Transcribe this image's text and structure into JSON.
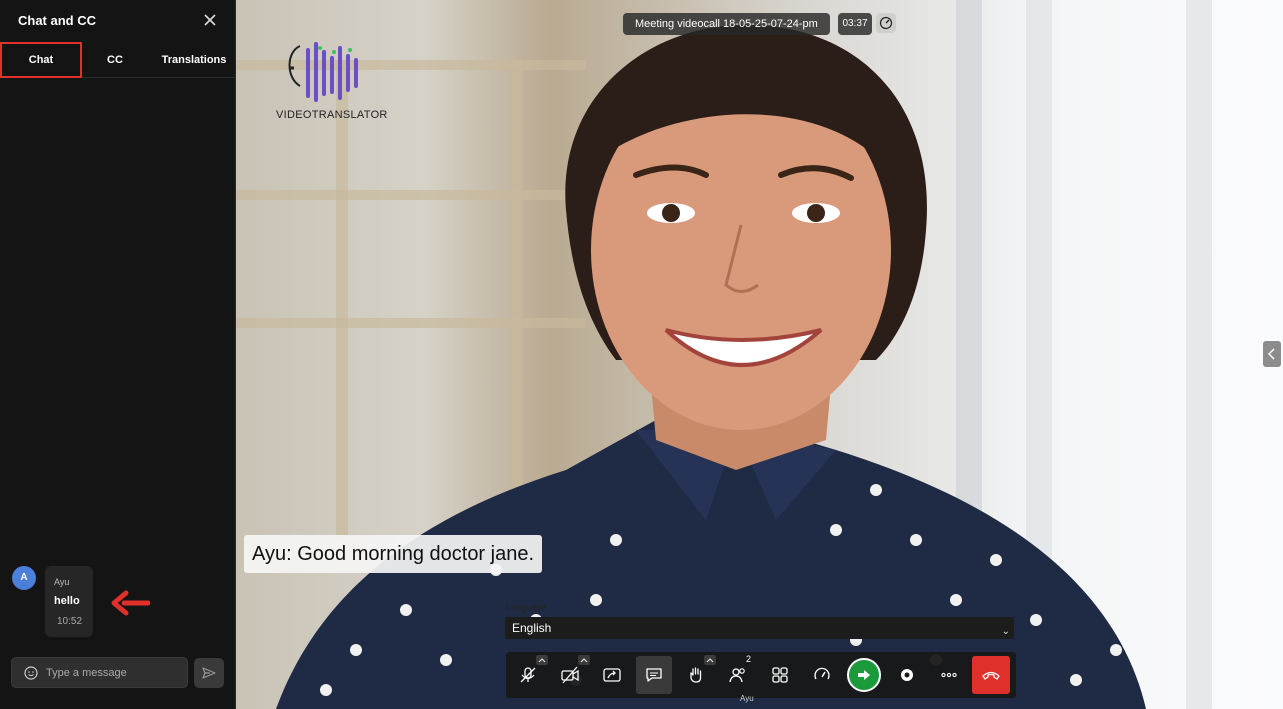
{
  "sidebar": {
    "title": "Chat and CC",
    "tabs": [
      "Chat",
      "CC",
      "Translations"
    ],
    "active_tab": "Chat",
    "messages": [
      {
        "avatar_initial": "A",
        "author": "Ayu",
        "text": "hello",
        "time": "10:52"
      }
    ],
    "input": {
      "placeholder": "Type a message",
      "value": ""
    }
  },
  "video": {
    "logo_text": "VIDEOTRANSLATOR",
    "meeting_title": "Meeting videocall 18-05-25-07-24-pm",
    "timer": "03:37",
    "caption": "Ayu: Good morning doctor jane.",
    "language": {
      "label": "Language",
      "selected": "English"
    },
    "toolbar": {
      "participants_count": "2",
      "user_name": "Ayu",
      "buttons": [
        "mic-off",
        "video-off",
        "share-screen",
        "chat",
        "raise-hand",
        "participants",
        "apps",
        "stats",
        "enter",
        "record",
        "more",
        "leave"
      ]
    }
  },
  "colors": {
    "highlight": "#e0302c",
    "accent_green": "#1b9a3c",
    "avatar_blue": "#4c7fd9",
    "leave_red": "#e0302c"
  }
}
